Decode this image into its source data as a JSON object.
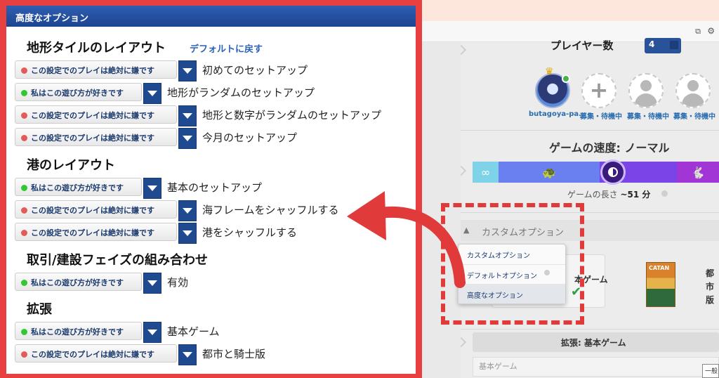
{
  "colors": {
    "frame_red": "#e84040",
    "header_blue": "#1c4390",
    "select_text": "#1a3a6e",
    "dislike_dot": "#e45a5a",
    "like_dot": "#32c832",
    "caret_blue": "#1f4a8f",
    "link_blue": "#2a62b8"
  },
  "advanced_panel": {
    "title": "高度なオプション",
    "reset_label": "デフォルトに戻す",
    "sections": [
      {
        "title": "地形タイルのレイアウト",
        "options": [
          {
            "preference": "この設定でのプレイは絶対に嫌です",
            "kind": "dislike",
            "label": "初めてのセットアップ"
          },
          {
            "preference": "私はこの遊び方が好きです",
            "kind": "like",
            "label": "地形がランダムのセットアップ"
          },
          {
            "preference": "この設定でのプレイは絶対に嫌です",
            "kind": "dislike",
            "label": "地形と数字がランダムのセットアップ"
          },
          {
            "preference": "この設定でのプレイは絶対に嫌です",
            "kind": "dislike",
            "label": "今月のセットアップ"
          }
        ]
      },
      {
        "title": "港のレイアウト",
        "options": [
          {
            "preference": "私はこの遊び方が好きです",
            "kind": "like",
            "label": "基本のセットアップ"
          },
          {
            "preference": "この設定でのプレイは絶対に嫌です",
            "kind": "dislike",
            "label": "海フレームをシャッフルする"
          },
          {
            "preference": "この設定でのプレイは絶対に嫌です",
            "kind": "dislike",
            "label": "港をシャッフルする"
          }
        ]
      },
      {
        "title": "取引/建設フェイズの組み合わせ",
        "options": [
          {
            "preference": "私はこの遊び方が好きです",
            "kind": "like",
            "label": "有効"
          }
        ]
      },
      {
        "title": "拡張",
        "options": [
          {
            "preference": "私はこの遊び方が好きです",
            "kind": "like",
            "label": "基本ゲーム"
          },
          {
            "preference": "この設定でのプレイは絶対に嫌です",
            "kind": "dislike",
            "label": "都市と騎士版"
          }
        ]
      }
    ]
  },
  "game_setup": {
    "players_label": "プレイヤー数",
    "players_value": "4",
    "players": [
      {
        "name": "butagoya-pa..."
      },
      {
        "name": "募集・待機中"
      },
      {
        "name": "募集・待機中"
      },
      {
        "name": "募集・待機中"
      }
    ],
    "speed_title": "ゲームの速度: ノーマル",
    "length_label": "ゲームの長さ",
    "length_value": "~51 分",
    "custom_header": "カスタムオプション",
    "dropdown": [
      "カスタムオプション",
      "デフォルトオプション",
      "高度なオプション"
    ],
    "base_card_text": "本ゲーム",
    "catan_box_label": "CATAN",
    "catan_side_text": [
      "都市",
      "版"
    ],
    "expansion_bar": "拡張: 基本ゲーム",
    "expansion_sub": "基本ゲーム",
    "expansion_tail": "一般"
  }
}
